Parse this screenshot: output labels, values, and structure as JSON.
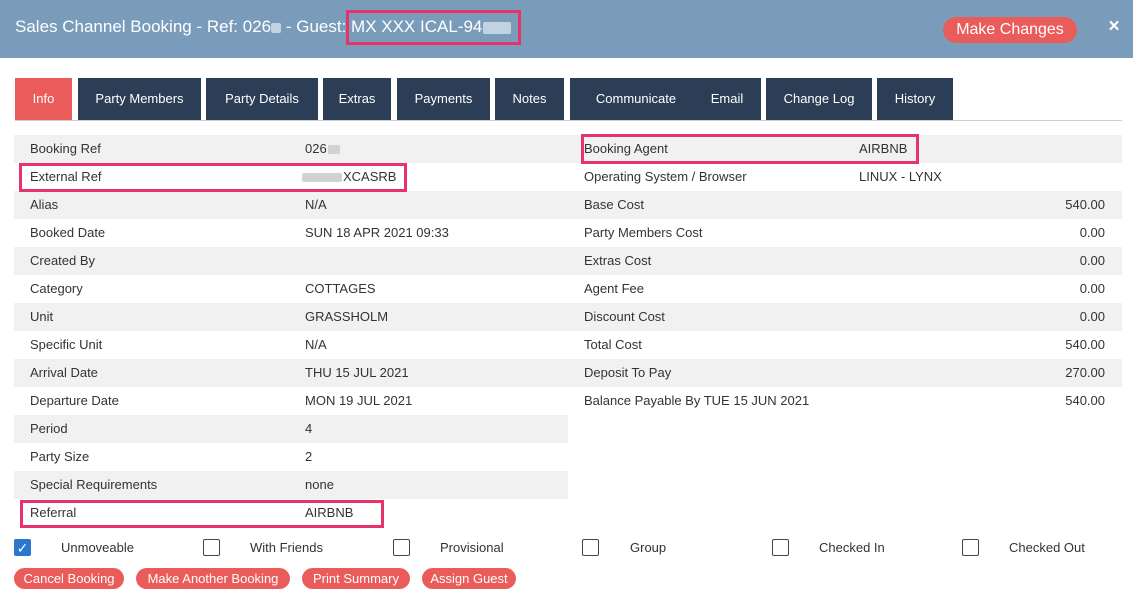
{
  "header": {
    "title_prefix": "Sales Channel Booking - Ref: 026",
    "title_guest_label": " - Guest: ",
    "guest_name": "MX XXX ICAL-94",
    "make_changes_label": "Make Changes",
    "close_symbol": "×"
  },
  "tabs": [
    {
      "label": "Info",
      "active": true
    },
    {
      "label": "Party Members"
    },
    {
      "label": "Party Details"
    },
    {
      "label": "Extras"
    },
    {
      "label": "Payments"
    },
    {
      "label": "Notes"
    },
    {
      "label": "Communicate"
    },
    {
      "label": "Email"
    },
    {
      "label": "Change Log"
    },
    {
      "label": "History"
    }
  ],
  "left_fields": [
    {
      "label": "Booking Ref",
      "value": "026"
    },
    {
      "label": "External Ref",
      "value": "XCASRB"
    },
    {
      "label": "Alias",
      "value": "N/A"
    },
    {
      "label": "Booked Date",
      "value": "SUN 18 APR 2021 09:33"
    },
    {
      "label": "Created By",
      "value": ""
    },
    {
      "label": "Category",
      "value": "COTTAGES"
    },
    {
      "label": "Unit",
      "value": "GRASSHOLM"
    },
    {
      "label": "Specific Unit",
      "value": "N/A"
    },
    {
      "label": "Arrival Date",
      "value": "THU 15 JUL 2021"
    },
    {
      "label": "Departure Date",
      "value": "MON 19 JUL 2021"
    },
    {
      "label": "Period",
      "value": "4"
    },
    {
      "label": "Party Size",
      "value": "2"
    },
    {
      "label": "Special Requirements",
      "value": "none"
    },
    {
      "label": "Referral",
      "value": "AIRBNB"
    }
  ],
  "right_fields": [
    {
      "label": "Booking Agent",
      "value": "AIRBNB"
    },
    {
      "label": "Operating System / Browser",
      "value": "LINUX - LYNX"
    },
    {
      "label": "Base Cost",
      "value": "540.00"
    },
    {
      "label": "Party Members Cost",
      "value": "0.00"
    },
    {
      "label": "Extras Cost",
      "value": "0.00"
    },
    {
      "label": "Agent Fee",
      "value": "0.00"
    },
    {
      "label": "Discount Cost",
      "value": "0.00"
    },
    {
      "label": "Total Cost",
      "value": "540.00"
    },
    {
      "label": "Deposit To Pay",
      "value": "270.00"
    },
    {
      "label": "Balance Payable By TUE 15 JUN 2021",
      "value": "540.00"
    }
  ],
  "checkboxes": [
    {
      "label": "Unmoveable",
      "checked": true
    },
    {
      "label": "With Friends",
      "checked": false
    },
    {
      "label": "Provisional",
      "checked": false
    },
    {
      "label": "Group",
      "checked": false
    },
    {
      "label": "Checked In",
      "checked": false
    },
    {
      "label": "Checked Out",
      "checked": false
    }
  ],
  "checkmark": "✓",
  "actions": [
    {
      "label": "Cancel Booking"
    },
    {
      "label": "Make Another Booking"
    },
    {
      "label": "Print Summary"
    },
    {
      "label": "Assign Guest"
    }
  ],
  "colors": {
    "header_bg": "#7a9cbb",
    "tab_bg": "#2c3e56",
    "accent": "#e95c5a",
    "highlight": "#e6336a",
    "checkbox_checked": "#2b77d0"
  }
}
